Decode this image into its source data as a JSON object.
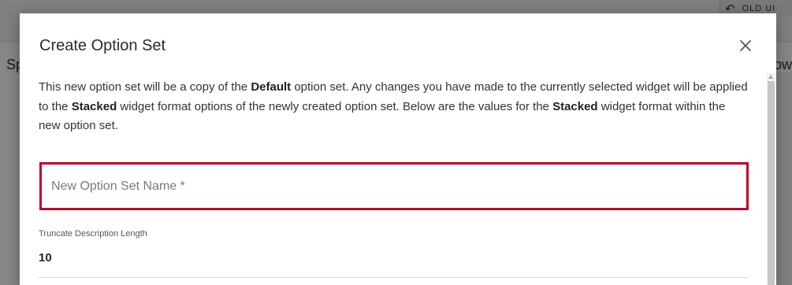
{
  "background": {
    "old_ui_label": "OLD UI",
    "left_text": "Sp",
    "right_text": "ow"
  },
  "dialog": {
    "title": "Create Option Set",
    "description": {
      "part1": "This new option set will be a copy of the ",
      "bold1": "Default",
      "part2": " option set. Any changes you have made to the currently selected widget will be applied to the ",
      "bold2": "Stacked",
      "part3": " widget format options of the newly created option set. Below are the values for the ",
      "bold3": "Stacked",
      "part4": " widget format within the new option set."
    },
    "name_field": {
      "placeholder": "New Option Set Name *",
      "value": "",
      "border_color": "#c0002a"
    },
    "truncate_field": {
      "label": "Truncate Description Length",
      "value": "10"
    }
  },
  "icons": {
    "close": "close-icon",
    "undo": "undo-icon"
  }
}
